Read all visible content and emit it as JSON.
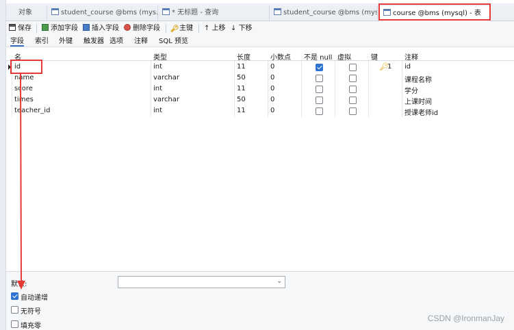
{
  "tabs": [
    {
      "label": "对象",
      "active": false
    },
    {
      "label": "student_course @bms (mys...",
      "active": false
    },
    {
      "label": "* 无标题 - 查询",
      "active": false
    },
    {
      "label": "student_course @bms (mys...",
      "active": false
    },
    {
      "label": "course @bms (mysql) - 表",
      "active": true
    }
  ],
  "toolbar": {
    "save": "保存",
    "add_field": "添加字段",
    "insert_field": "插入字段",
    "delete_field": "删除字段",
    "primary_key": "主键",
    "move_up": "上移",
    "move_down": "下移"
  },
  "subtabs": [
    "字段",
    "索引",
    "外键",
    "触发器",
    "选项",
    "注释",
    "SQL 预览"
  ],
  "grid": {
    "headers": {
      "name": "名",
      "type": "类型",
      "length": "长度",
      "decimals": "小数点",
      "not_null": "不是 null",
      "virtual": "虚拟",
      "key": "键",
      "comment": "注释"
    },
    "rows": [
      {
        "name": "id",
        "type": "int",
        "length": "11",
        "decimals": "0",
        "not_null": true,
        "virtual": false,
        "key": "1",
        "comment": "id"
      },
      {
        "name": "name",
        "type": "varchar",
        "length": "50",
        "decimals": "0",
        "not_null": false,
        "virtual": false,
        "key": "",
        "comment": "课程名称"
      },
      {
        "name": "score",
        "type": "int",
        "length": "11",
        "decimals": "0",
        "not_null": false,
        "virtual": false,
        "key": "",
        "comment": "学分"
      },
      {
        "name": "times",
        "type": "varchar",
        "length": "50",
        "decimals": "0",
        "not_null": false,
        "virtual": false,
        "key": "",
        "comment": "上课时间"
      },
      {
        "name": "teacher_id",
        "type": "int",
        "length": "11",
        "decimals": "0",
        "not_null": false,
        "virtual": false,
        "key": "",
        "comment": "授课老师id"
      }
    ]
  },
  "bottom": {
    "default_label": "默认:",
    "default_value": "",
    "auto_increment": {
      "label": "自动递增",
      "checked": true
    },
    "unsigned": {
      "label": "无符号",
      "checked": false
    },
    "zerofill": {
      "label": "填充零",
      "checked": false
    }
  },
  "watermark": "CSDN @IronmanJay",
  "colors": {
    "accent": "#2e72d2",
    "annotation": "#e53935",
    "key": "#d8a100"
  }
}
